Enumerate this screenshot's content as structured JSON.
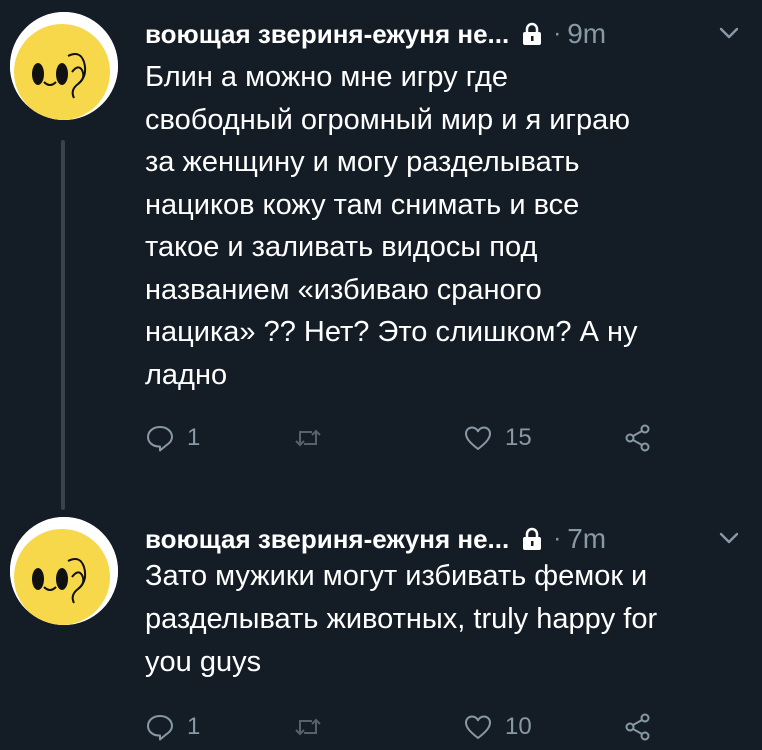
{
  "colors": {
    "background": "#141d26",
    "text": "#ffffff",
    "muted": "#8899a6",
    "thread_line": "#38444d",
    "avatar_face": "#f7d84a"
  },
  "tweets": [
    {
      "display_name": "воющая звериня-ежуня не...",
      "separator": "·",
      "time": "9m",
      "lines": [
        "Блин а можно мне игру где",
        "свободный огромный мир и я играю",
        "за женщину и могу разделывать",
        "нациков кожу там снимать и все",
        "такое и заливать видосы под",
        "названием «избиваю сраного",
        "нацика» ?? Нет? Это слишком? А ну",
        "ладно"
      ],
      "reply_count": "1",
      "retweet_count": "",
      "like_count": "15",
      "icons": [
        "lock-icon",
        "chevron-down-icon",
        "reply-icon",
        "retweet-icon",
        "heart-icon",
        "share-icon"
      ]
    },
    {
      "display_name": "воющая звериня-ежуня не...",
      "separator": "·",
      "time": "7m",
      "lines": [
        "Зато мужики могут избивать фемок и",
        "разделывать животных, truly happy for",
        "you guys"
      ],
      "reply_count": "1",
      "retweet_count": "",
      "like_count": "10",
      "icons": [
        "lock-icon",
        "chevron-down-icon",
        "reply-icon",
        "retweet-icon",
        "heart-icon",
        "share-icon"
      ]
    }
  ]
}
